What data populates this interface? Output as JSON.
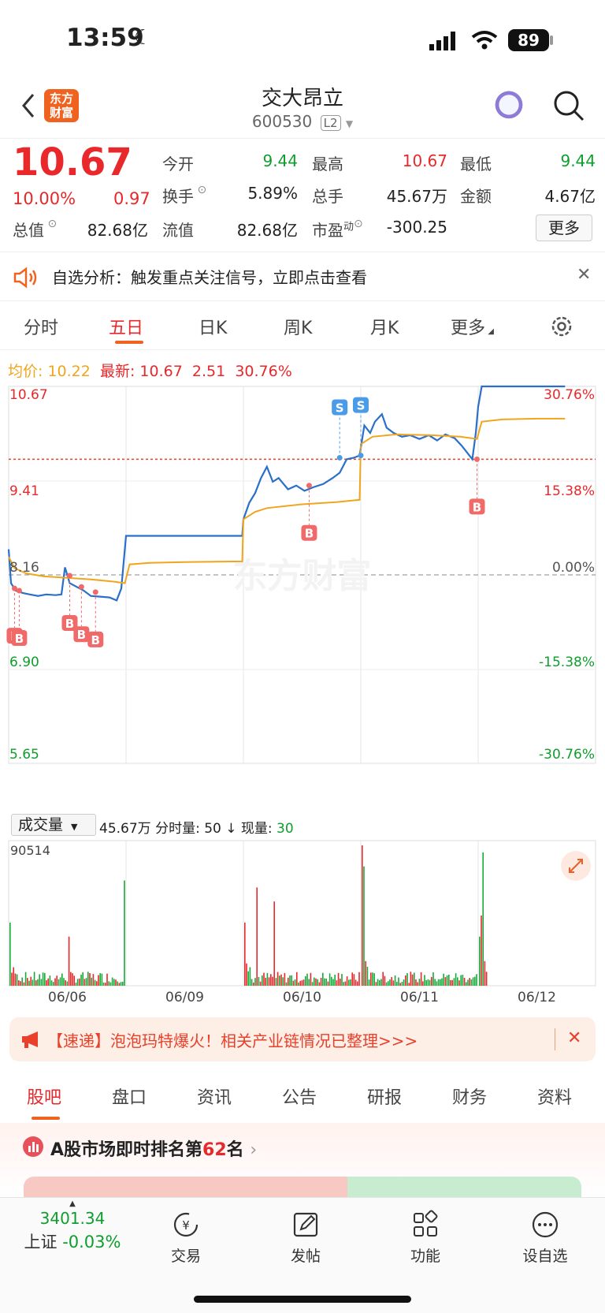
{
  "status_bar": {
    "time": "13:59",
    "battery": "89"
  },
  "header": {
    "logo_text": "东方财富",
    "stock_name": "交大昂立",
    "stock_code": "600530",
    "level_badge": "L2"
  },
  "quote": {
    "price": "10.67",
    "change_pct": "10.00%",
    "change_amt": "0.97",
    "fields": [
      {
        "label": "今开",
        "value": "9.44",
        "color": "#0f9d2e"
      },
      {
        "label": "最高",
        "value": "10.67",
        "color": "#e8282a"
      },
      {
        "label": "最低",
        "value": "9.44",
        "color": "#0f9d2e"
      },
      {
        "label": "换手",
        "value": "5.89%",
        "color": "#222222"
      },
      {
        "label": "总手",
        "value": "45.67万",
        "color": "#222222"
      },
      {
        "label": "金额",
        "value": "4.67亿",
        "color": "#222222"
      },
      {
        "label": "总值",
        "value": "82.68亿",
        "color": "#222222"
      },
      {
        "label": "流值",
        "value": "82.68亿",
        "color": "#222222"
      },
      {
        "label": "市盈",
        "label_sup": "动",
        "value": "-300.25",
        "color": "#222222"
      }
    ],
    "more_button": "更多"
  },
  "banner": {
    "text": "自选分析：触发重点关注信号，立即点击查看"
  },
  "chart_tabs": [
    "分时",
    "五日",
    "日K",
    "周K",
    "月K",
    "更多"
  ],
  "chart_tabs_active": 1,
  "chart_info": {
    "avg_label": "均价:",
    "avg_value": "10.22",
    "latest_label": "最新:",
    "latest_value": "10.67",
    "latest_change": "2.51",
    "latest_pct": "30.76%"
  },
  "chart_data": {
    "type": "line",
    "title": "",
    "x_labels": [
      "06/06",
      "06/09",
      "06/10",
      "06/11",
      "06/12"
    ],
    "ylim": [
      5.65,
      10.67
    ],
    "price_ticks_left": [
      "10.67",
      "9.41",
      "8.16",
      "6.90",
      "5.65"
    ],
    "pct_ticks_right": [
      "30.76%",
      "15.38%",
      "0.00%",
      "-15.38%",
      "-30.76%"
    ],
    "prev_close": 8.16,
    "limit_line": 9.7,
    "series": [
      {
        "name": "价格",
        "color": "#2a6fc9",
        "values": [
          [
            0,
            8.5
          ],
          [
            0.02,
            8.05
          ],
          [
            0.06,
            7.95
          ],
          [
            0.12,
            7.92
          ],
          [
            0.18,
            7.9
          ],
          [
            0.25,
            7.88
          ],
          [
            0.32,
            7.9
          ],
          [
            0.4,
            7.89
          ],
          [
            0.45,
            7.9
          ],
          [
            0.48,
            8.26
          ],
          [
            0.52,
            8.05
          ],
          [
            0.58,
            8.0
          ],
          [
            0.64,
            7.95
          ],
          [
            0.7,
            7.88
          ],
          [
            0.78,
            7.87
          ],
          [
            0.86,
            7.86
          ],
          [
            0.92,
            7.82
          ],
          [
            0.96,
            7.98
          ],
          [
            1.0,
            8.68
          ],
          [
            1.03,
            8.68
          ],
          [
            1.2,
            8.68
          ],
          [
            1.5,
            8.68
          ],
          [
            1.99,
            8.68
          ],
          [
            2.0,
            8.9
          ],
          [
            2.05,
            9.12
          ],
          [
            2.1,
            9.25
          ],
          [
            2.15,
            9.45
          ],
          [
            2.2,
            9.6
          ],
          [
            2.25,
            9.4
          ],
          [
            2.3,
            9.45
          ],
          [
            2.38,
            9.3
          ],
          [
            2.45,
            9.35
          ],
          [
            2.52,
            9.28
          ],
          [
            2.6,
            9.33
          ],
          [
            2.68,
            9.37
          ],
          [
            2.76,
            9.45
          ],
          [
            2.82,
            9.52
          ],
          [
            2.88,
            9.7
          ],
          [
            2.94,
            9.72
          ],
          [
            2.99,
            9.75
          ],
          [
            3.0,
            9.85
          ],
          [
            3.03,
            10.15
          ],
          [
            3.08,
            10.05
          ],
          [
            3.12,
            10.2
          ],
          [
            3.18,
            10.3
          ],
          [
            3.22,
            10.12
          ],
          [
            3.28,
            10.05
          ],
          [
            3.35,
            10.0
          ],
          [
            3.42,
            10.02
          ],
          [
            3.5,
            9.97
          ],
          [
            3.58,
            10.02
          ],
          [
            3.65,
            9.95
          ],
          [
            3.72,
            10.03
          ],
          [
            3.8,
            9.98
          ],
          [
            3.86,
            9.88
          ],
          [
            3.9,
            9.8
          ],
          [
            3.95,
            9.7
          ],
          [
            3.98,
            10.05
          ],
          [
            4.0,
            10.4
          ],
          [
            4.03,
            10.67
          ],
          [
            4.3,
            10.67
          ],
          [
            4.6,
            10.67
          ],
          [
            4.74,
            10.67
          ]
        ]
      },
      {
        "name": "均价",
        "color": "#f0a51e",
        "values": [
          [
            0,
            8.4
          ],
          [
            0.05,
            8.25
          ],
          [
            0.15,
            8.18
          ],
          [
            0.3,
            8.14
          ],
          [
            0.5,
            8.12
          ],
          [
            0.7,
            8.1
          ],
          [
            0.9,
            8.07
          ],
          [
            0.99,
            8.05
          ],
          [
            1.03,
            8.3
          ],
          [
            1.2,
            8.32
          ],
          [
            1.5,
            8.33
          ],
          [
            1.99,
            8.34
          ],
          [
            2.0,
            8.9
          ],
          [
            2.1,
            9.0
          ],
          [
            2.2,
            9.05
          ],
          [
            2.5,
            9.1
          ],
          [
            2.8,
            9.13
          ],
          [
            2.99,
            9.16
          ],
          [
            3.0,
            9.9
          ],
          [
            3.1,
            10.0
          ],
          [
            3.3,
            10.03
          ],
          [
            3.6,
            10.02
          ],
          [
            3.85,
            10.0
          ],
          [
            3.99,
            9.97
          ],
          [
            4.03,
            10.2
          ],
          [
            4.2,
            10.23
          ],
          [
            4.5,
            10.24
          ],
          [
            4.74,
            10.24
          ]
        ]
      }
    ],
    "markers": [
      {
        "type": "B",
        "x": 0.05,
        "y": 7.98
      },
      {
        "type": "B",
        "x": 0.09,
        "y": 7.95
      },
      {
        "type": "B",
        "x": 0.52,
        "y": 8.15
      },
      {
        "type": "B",
        "x": 0.62,
        "y": 8.0
      },
      {
        "type": "B",
        "x": 0.74,
        "y": 7.93
      },
      {
        "type": "B",
        "x": 2.56,
        "y": 9.35
      },
      {
        "type": "S",
        "x": 2.82,
        "y": 9.72
      },
      {
        "type": "S",
        "x": 3.0,
        "y": 9.75
      },
      {
        "type": "B",
        "x": 3.99,
        "y": 9.7
      }
    ]
  },
  "volume": {
    "select_label": "成交量",
    "info": "45.67万 分时量: 50",
    "arrow": "↓",
    "current_label": "现量:",
    "current_value": "30",
    "max_label": "90514"
  },
  "news": {
    "text": "【速递】泡泡玛特爆火！相关产业链情况已整理>>>"
  },
  "subtabs": [
    "股吧",
    "盘口",
    "资讯",
    "公告",
    "研报",
    "财务",
    "资料"
  ],
  "rank": {
    "prefix": "A股市场即时排名第",
    "rank": "62",
    "suffix": "名"
  },
  "bottom_nav": {
    "index_value": "3401.34",
    "index_label": "上证",
    "index_change": "-0.03%",
    "items": [
      "交易",
      "发帖",
      "功能",
      "设自选"
    ]
  },
  "colors": {
    "red": "#e8282a",
    "green": "#0f9d2e",
    "blue": "#2a6fc9",
    "orange": "#f0a51e",
    "brand": "#f06220"
  }
}
